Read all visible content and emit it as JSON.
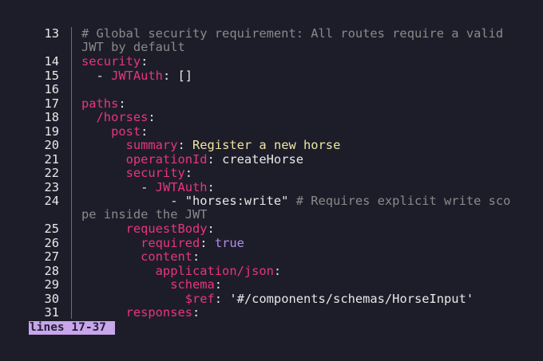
{
  "editor": {
    "lines": [
      {
        "num": "13",
        "parts": [
          {
            "t": "# Global security requirement: All routes require a valid",
            "c": "c"
          }
        ]
      },
      {
        "num": "14",
        "parts": [
          {
            "t": "security",
            "c": "k"
          },
          {
            "t": ":",
            "c": ""
          }
        ]
      },
      {
        "num": "15",
        "parts": [
          {
            "t": "  - ",
            "c": ""
          },
          {
            "t": "JWTAuth",
            "c": "k"
          },
          {
            "t": ": []",
            "c": ""
          }
        ]
      },
      {
        "num": "16",
        "parts": []
      },
      {
        "num": "17",
        "parts": [
          {
            "t": "paths",
            "c": "k"
          },
          {
            "t": ":",
            "c": ""
          }
        ]
      },
      {
        "num": "18",
        "parts": [
          {
            "t": "  /horses",
            "c": "k"
          },
          {
            "t": ":",
            "c": ""
          }
        ]
      },
      {
        "num": "19",
        "parts": [
          {
            "t": "    post",
            "c": "k"
          },
          {
            "t": ":",
            "c": ""
          }
        ]
      },
      {
        "num": "20",
        "parts": [
          {
            "t": "      summary",
            "c": "k"
          },
          {
            "t": ": ",
            "c": ""
          },
          {
            "t": "Register a new horse",
            "c": "s"
          }
        ]
      },
      {
        "num": "21",
        "parts": [
          {
            "t": "      operationId",
            "c": "k"
          },
          {
            "t": ": createHorse",
            "c": ""
          }
        ]
      },
      {
        "num": "22",
        "parts": [
          {
            "t": "      security",
            "c": "k"
          },
          {
            "t": ":",
            "c": ""
          }
        ]
      },
      {
        "num": "23",
        "parts": [
          {
            "t": "        - ",
            "c": ""
          },
          {
            "t": "JWTAuth",
            "c": "k"
          },
          {
            "t": ":",
            "c": ""
          }
        ]
      },
      {
        "num": "24",
        "parts": [
          {
            "t": "            - \"horses:write\" ",
            "c": ""
          },
          {
            "t": "# Requires explicit write sco",
            "c": "c"
          }
        ]
      },
      {
        "num": "25",
        "parts": [
          {
            "t": "      requestBody",
            "c": "k"
          },
          {
            "t": ":",
            "c": ""
          }
        ]
      },
      {
        "num": "26",
        "parts": [
          {
            "t": "        required",
            "c": "k"
          },
          {
            "t": ": ",
            "c": ""
          },
          {
            "t": "true",
            "c": "n"
          }
        ]
      },
      {
        "num": "27",
        "parts": [
          {
            "t": "        content",
            "c": "k"
          },
          {
            "t": ":",
            "c": ""
          }
        ]
      },
      {
        "num": "28",
        "parts": [
          {
            "t": "          application/json",
            "c": "k"
          },
          {
            "t": ":",
            "c": ""
          }
        ]
      },
      {
        "num": "29",
        "parts": [
          {
            "t": "            schema",
            "c": "k"
          },
          {
            "t": ":",
            "c": ""
          }
        ]
      },
      {
        "num": "30",
        "parts": [
          {
            "t": "              $ref",
            "c": "k"
          },
          {
            "t": ": '#/components/schemas/HorseInput'",
            "c": ""
          }
        ]
      },
      {
        "num": "31",
        "parts": [
          {
            "t": "      responses",
            "c": "k"
          },
          {
            "t": ":",
            "c": ""
          }
        ]
      }
    ],
    "wrap_13": "JWT by default",
    "wrap_24": "pe inside the JWT"
  },
  "status": {
    "label": "lines 17-37"
  },
  "colors": {
    "background": "#1d1d2a",
    "key": "#e8357e",
    "comment": "#8a8a8a",
    "string": "#f0e6a0",
    "boolean": "#b48ce8",
    "status_bg": "#c8a6ea"
  }
}
